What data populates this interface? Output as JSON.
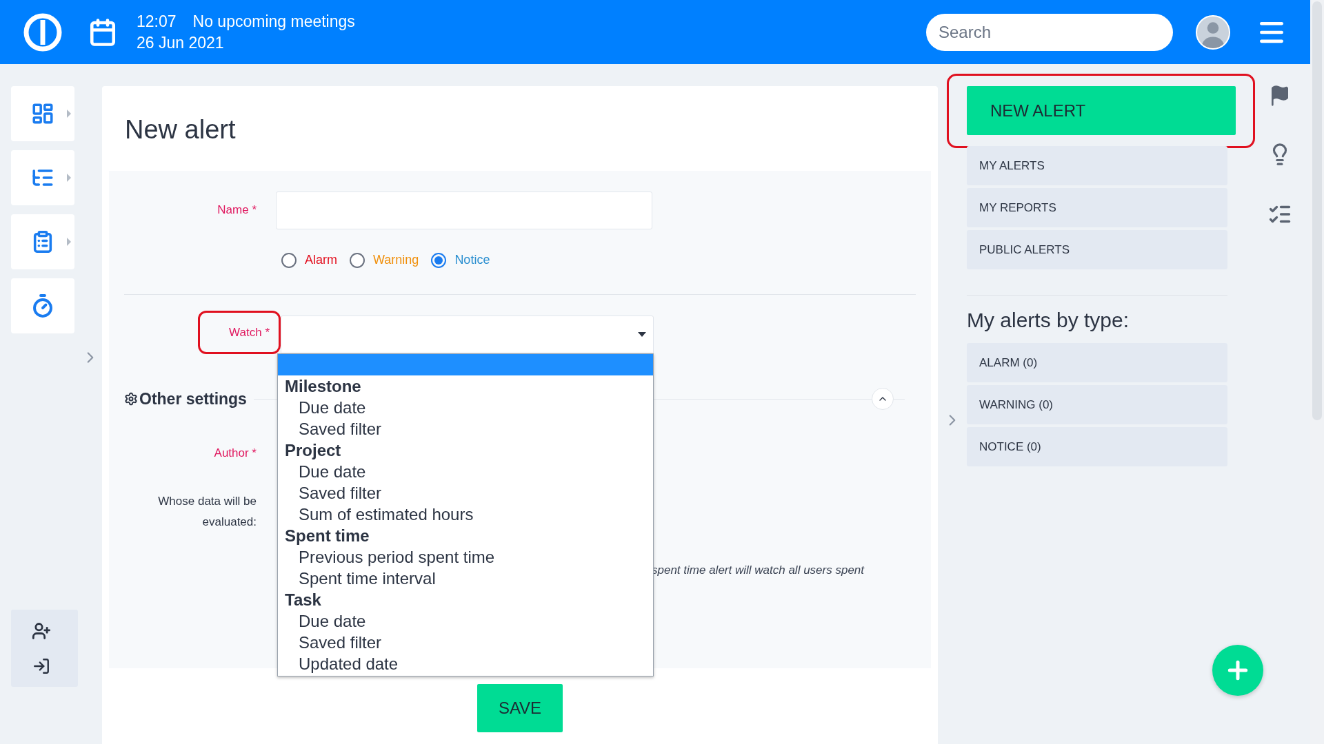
{
  "header": {
    "time": "12:07",
    "meetings": "No upcoming meetings",
    "date": "26 Jun 2021",
    "search": {
      "placeholder": "Search"
    }
  },
  "page": {
    "title": "New alert"
  },
  "form": {
    "name_label": "Name *",
    "alert_types": [
      {
        "label": "Alarm",
        "color": "#e3101f",
        "selected": false
      },
      {
        "label": "Warning",
        "color": "#f0900c",
        "selected": false
      },
      {
        "label": "Notice",
        "color": "#2a8fd0",
        "selected": true
      }
    ],
    "watch_label": "Watch *",
    "watch_dropdown": {
      "expanded": true,
      "blank_option_highlighted": true,
      "groups": [
        {
          "label": "Milestone",
          "children": [
            {
              "label": "Due date"
            },
            {
              "label": "Saved filter"
            }
          ]
        },
        {
          "label": "Project",
          "children": [
            {
              "label": "Due date"
            },
            {
              "label": "Saved filter"
            },
            {
              "label": "Sum of estimated hours"
            }
          ]
        },
        {
          "label": "Spent time",
          "children": [
            {
              "label": "Previous period spent time"
            },
            {
              "label": "Spent time interval"
            }
          ]
        },
        {
          "label": "Task",
          "children": [
            {
              "label": "Due date"
            },
            {
              "label": "Saved filter"
            },
            {
              "label": "Updated date"
            }
          ]
        }
      ]
    },
    "other_settings": {
      "title": "Other settings",
      "expanded": true
    },
    "author_label": "Author *",
    "whose_data_label": "Whose data will be evaluated:",
    "note": "spent time alert will watch all users spent"
  },
  "save_button": "SAVE",
  "sidebar": {
    "new_alert": "NEW ALERT",
    "links": [
      "MY ALERTS",
      "MY REPORTS",
      "PUBLIC ALERTS"
    ],
    "section_title": "My alerts by type:",
    "types": [
      "ALARM (0)",
      "WARNING (0)",
      "NOTICE (0)"
    ]
  }
}
